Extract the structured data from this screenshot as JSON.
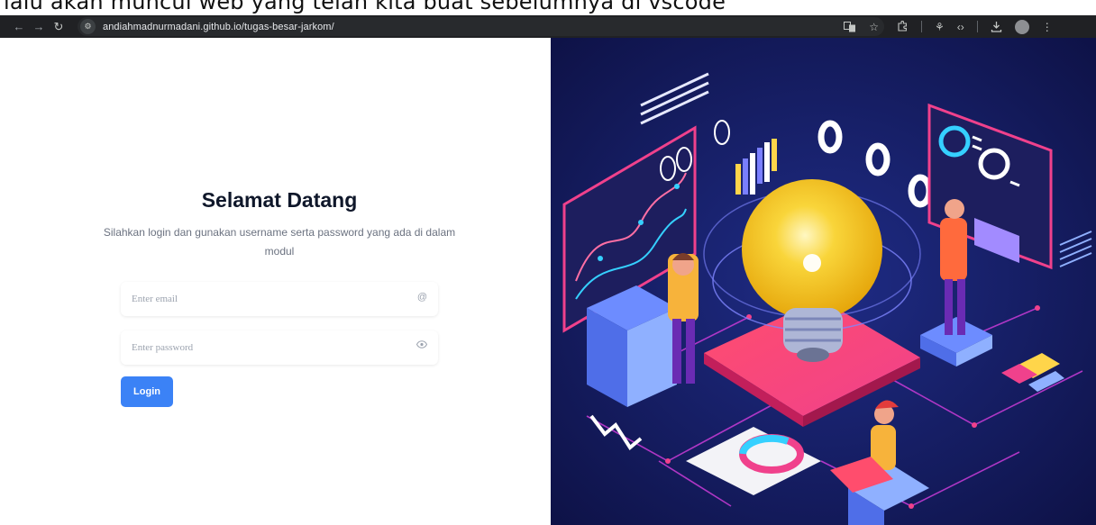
{
  "caption": {
    "text": "lalu akan muncul web yang telah kita buat sebelumnya di vscode"
  },
  "browser": {
    "url": "andiahmadnurmadani.github.io/tugas-besar-jarkom/",
    "icons": [
      "back-arrow-icon",
      "forward-arrow-icon",
      "reload-icon",
      "site-settings-icon",
      "translate-icon",
      "star-icon",
      "extensions-icon",
      "read-aloud-icon",
      "dev-tools-icon",
      "download-icon",
      "profile-icon",
      "menu-icon"
    ]
  },
  "login": {
    "title": "Selamat Datang",
    "subtitle": "Silahkan login dan gunakan username serta password yang ada di dalam modul",
    "email_placeholder": "Enter email",
    "password_placeholder": "Enter password",
    "button_label": "Login"
  },
  "colors": {
    "accent": "#3b82f6",
    "illustration_bg": "#141a55",
    "bulb": "#f7c520",
    "neon_pink": "#f0418c"
  }
}
